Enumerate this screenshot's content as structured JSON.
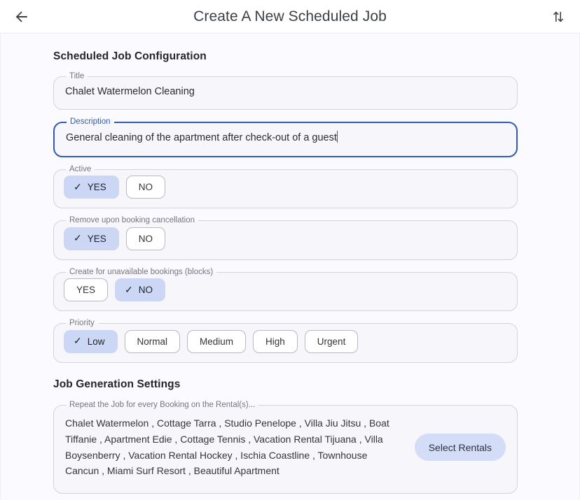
{
  "appbar": {
    "back_icon": "arrow-left-icon",
    "title": "Create A New Scheduled Job",
    "action_icon": "sort-up-down-icon"
  },
  "colors": {
    "accent_selected_chip": "#ccd6f5",
    "accent_focus_border": "#2f5bb7",
    "field_background": "#f7f6fa",
    "page_background": "#fafaff",
    "pill_button": "#d4ddf8"
  },
  "sections": {
    "configuration_title": "Scheduled Job Configuration",
    "generation_title": "Job Generation Settings"
  },
  "fields": {
    "title": {
      "label": "Title",
      "value": "Chalet Watermelon Cleaning",
      "placeholder": "Title",
      "focused": false
    },
    "description": {
      "label": "Description",
      "value": "General cleaning of the apartment after check-out of a guest",
      "placeholder": "Description",
      "focused": true
    }
  },
  "toggles": [
    {
      "label": "Active",
      "options": [
        {
          "label": "YES",
          "selected": true
        },
        {
          "label": "NO",
          "selected": false
        }
      ]
    },
    {
      "label": "Remove upon booking cancellation",
      "options": [
        {
          "label": "YES",
          "selected": true
        },
        {
          "label": "NO",
          "selected": false
        }
      ]
    },
    {
      "label": "Create for unavailable bookings (blocks)",
      "options": [
        {
          "label": "YES",
          "selected": false
        },
        {
          "label": "NO",
          "selected": true
        }
      ]
    },
    {
      "label": "Priority",
      "options": [
        {
          "label": "Low",
          "selected": true
        },
        {
          "label": "Normal",
          "selected": false
        },
        {
          "label": "Medium",
          "selected": false
        },
        {
          "label": "High",
          "selected": false
        },
        {
          "label": "Urgent",
          "selected": false
        }
      ]
    }
  ],
  "rentals": {
    "label": "Repeat the Job for every Booking on the Rental(s)...",
    "value": "Chalet Watermelon , Cottage Tarra , Studio Penelope , Villa Jiu Jitsu , Boat Tiffanie , Apartment Edie , Cottage Tennis , Vacation Rental Tijuana , Villa Boysenberry , Vacation Rental Hockey , Ischia Coastline , Townhouse Cancun , Miami Surf Resort , Beautiful Apartment",
    "select_button": "Select Rentals",
    "checkmark_glyph": "✓"
  }
}
